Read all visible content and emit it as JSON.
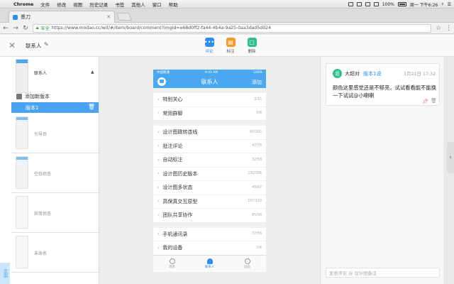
{
  "menubar": {
    "app": "Chrome",
    "items": [
      "文件",
      "修改",
      "视图",
      "历史记录",
      "书签",
      "其他人",
      "窗口",
      "帮助"
    ],
    "battery": "100%",
    "clock": "周一 下午6:26"
  },
  "browser": {
    "tab_title": "墨刀",
    "secure_label": "安全",
    "url": "https://www.modao.cc/wit/#/item/board/comment?imgId=e68d0ff2-fa44-4b4a-9a25-0aa3dad5d024"
  },
  "app_header": {
    "project_name": "联系人",
    "tools": [
      {
        "label": "评论",
        "color": "#2d8cf0"
      },
      {
        "label": "标注",
        "color": "#f59a23"
      },
      {
        "label": "删除",
        "color": "#2fc089"
      }
    ]
  },
  "pages_panel": {
    "first_page_title": "联系人",
    "add_version": "添加新版本",
    "selected_version": "版本1",
    "pages": [
      "引导页",
      "空白状态",
      "异常状态",
      "未命名"
    ],
    "side_tab": "页面"
  },
  "phone": {
    "status_left": "中国联通",
    "status_mid": "9:41 AM",
    "status_right": "100%",
    "nav_title": "联系人",
    "nav_right": "添加",
    "groups": [
      [
        {
          "label": "特别关心",
          "count": "3/15"
        },
        {
          "label": "常用群聊",
          "count": "0/8"
        }
      ],
      [
        {
          "label": "设计图跳转连线",
          "count": "65/102"
        },
        {
          "label": "批注评论",
          "count": "47/76"
        },
        {
          "label": "自动标注",
          "count": "32/58"
        },
        {
          "label": "设计图历史版本",
          "count": "230/306"
        },
        {
          "label": "设计图多状态",
          "count": "48/67"
        },
        {
          "label": "高保真交互原型",
          "count": "107/120"
        },
        {
          "label": "团队共享协作",
          "count": "85/98"
        }
      ],
      [
        {
          "label": "手机通讯录",
          "count": "37/56"
        },
        {
          "label": "我的设备",
          "count": "3/4"
        }
      ]
    ],
    "tabs": [
      "消息",
      "联系人",
      "动态"
    ]
  },
  "comment": {
    "avatar_text": "超",
    "author": "大超对",
    "version": "版本1说",
    "time": "1月21日 17:32",
    "text": "颜色这里感觉还是不够亮，试试看看能不能换一下试试@小喇喇",
    "input_placeholder": "发表评论 @ 设计图备注"
  }
}
